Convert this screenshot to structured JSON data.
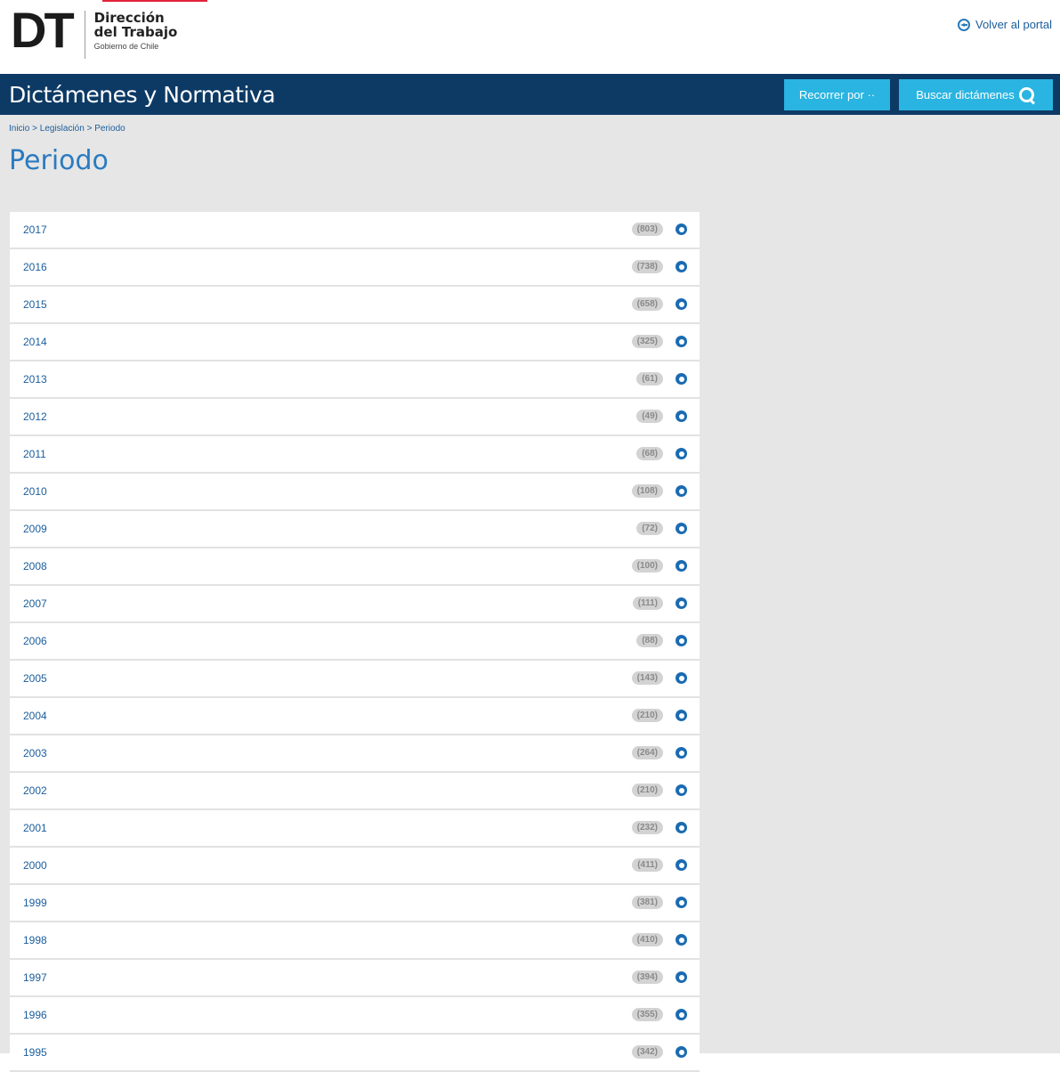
{
  "header": {
    "logo": {
      "mark": "DT",
      "line1": "Dirección",
      "line2": "del Trabajo",
      "line3": "Gobierno de Chile"
    },
    "back_link": "Volver al portal"
  },
  "navbar": {
    "title": "Dictámenes y Normativa",
    "recorrer_label": "Recorrer por ··",
    "buscar_label": "Buscar dictámenes"
  },
  "breadcrumb": {
    "items": [
      "Inicio",
      "Legislación",
      "Periodo"
    ],
    "separator": " > "
  },
  "page_title": "Periodo",
  "periods": [
    {
      "year": "2017",
      "count": "(803)"
    },
    {
      "year": "2016",
      "count": "(738)"
    },
    {
      "year": "2015",
      "count": "(658)"
    },
    {
      "year": "2014",
      "count": "(325)"
    },
    {
      "year": "2013",
      "count": "(61)"
    },
    {
      "year": "2012",
      "count": "(49)"
    },
    {
      "year": "2011",
      "count": "(68)"
    },
    {
      "year": "2010",
      "count": "(108)"
    },
    {
      "year": "2009",
      "count": "(72)"
    },
    {
      "year": "2008",
      "count": "(100)"
    },
    {
      "year": "2007",
      "count": "(111)"
    },
    {
      "year": "2006",
      "count": "(88)"
    },
    {
      "year": "2005",
      "count": "(143)"
    },
    {
      "year": "2004",
      "count": "(210)"
    },
    {
      "year": "2003",
      "count": "(264)"
    },
    {
      "year": "2002",
      "count": "(210)"
    },
    {
      "year": "2001",
      "count": "(232)"
    },
    {
      "year": "2000",
      "count": "(411)"
    },
    {
      "year": "1999",
      "count": "(381)"
    },
    {
      "year": "1998",
      "count": "(410)"
    },
    {
      "year": "1997",
      "count": "(394)"
    },
    {
      "year": "1996",
      "count": "(355)"
    },
    {
      "year": "1995",
      "count": "(342)"
    }
  ],
  "colors": {
    "navbar": "#0d3a65",
    "button": "#29b4e1",
    "link": "#1a5d9c",
    "title": "#2b7bc0",
    "background": "#e6e6e6"
  },
  "icons": {
    "back": "circle-arrow-left-icon",
    "search": "search-icon",
    "row": "circle-dot-icon"
  }
}
